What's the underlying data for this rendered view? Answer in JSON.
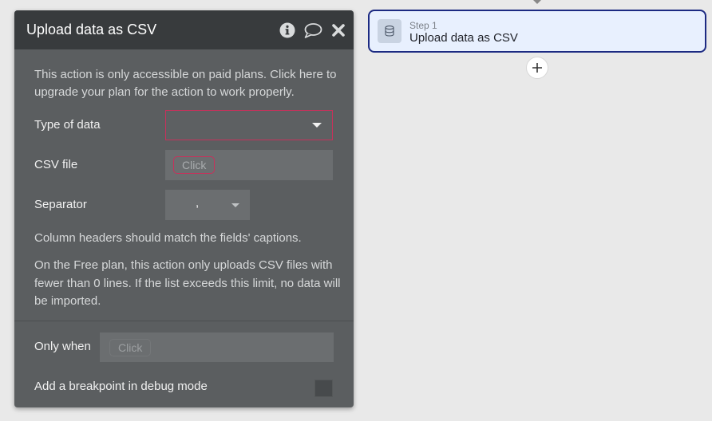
{
  "panel": {
    "title": "Upload data as CSV",
    "icons": [
      "info-icon",
      "comment-icon",
      "close-icon"
    ],
    "notice": "This action is only accessible on paid plans. Click here to upgrade your plan for the action to work properly.",
    "fields": {
      "type_of_data": {
        "label": "Type of data",
        "value": ""
      },
      "csv_file": {
        "label": "CSV file",
        "placeholder": "Click"
      },
      "separator": {
        "label": "Separator",
        "value": ","
      }
    },
    "headers_note": "Column headers should match the fields' captions.",
    "free_plan_note": "On the Free plan, this action only uploads CSV files with fewer than 0 lines. If the list exceeds this limit, no data will be imported.",
    "only_when": {
      "label": "Only when",
      "placeholder": "Click"
    },
    "breakpoint": {
      "label": "Add a breakpoint in debug mode",
      "checked": false
    }
  },
  "workflow": {
    "step": {
      "label": "Step 1",
      "name": "Upload data as CSV",
      "icon": "database-icon"
    },
    "add_button": "plus-icon"
  },
  "colors": {
    "panel_bg": "#5b5e60",
    "header_bg": "#383b3d",
    "error_border": "#c7315b",
    "step_border": "#1c2a82",
    "step_bg": "#e8f0fe"
  }
}
